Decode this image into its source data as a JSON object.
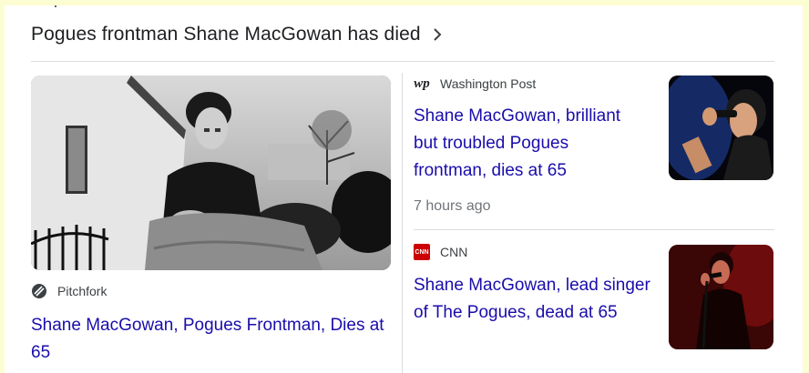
{
  "header": {
    "title": "Pogues frontman Shane MacGowan has died"
  },
  "icons": {
    "chevron": "chevron-right-icon"
  },
  "colors": {
    "headline_link": "#1a0dab",
    "page_bg": "#fdfdd3",
    "cnn_red": "#cc0000"
  },
  "main_story": {
    "source": "Pitchfork",
    "headline": "Shane MacGowan, Pogues Frontman, Dies at 65"
  },
  "side_stories": [
    {
      "source": "Washington Post",
      "logo_text": "wp",
      "headline": "Shane MacGowan, brilliant but troubled Pogues frontman, dies at 65",
      "time": "7 hours ago"
    },
    {
      "source": "CNN",
      "logo_text": "CNN",
      "headline": "Shane MacGowan, lead singer of The Pogues, dead at 65"
    }
  ]
}
